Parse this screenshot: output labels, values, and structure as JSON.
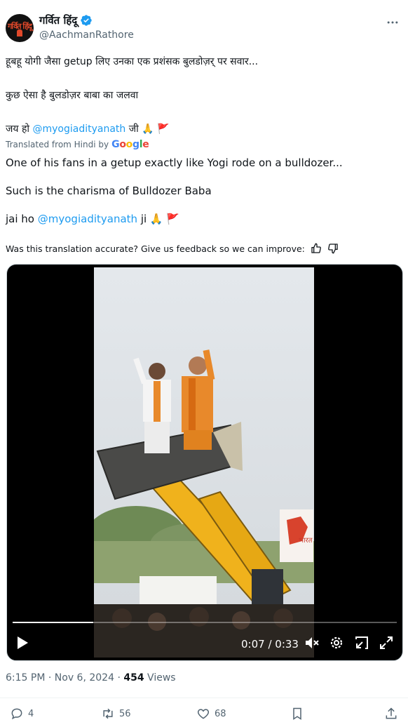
{
  "author": {
    "display_name": "गर्वित हिंदू",
    "handle": "@AachmanRathore",
    "avatar_text": "गर्वित हिंदू"
  },
  "post": {
    "hindi_line1": "हूबहू योगी जैसा getup लिए उनका एक प्रशंसक बुलडोज़र् पर सवार...",
    "hindi_line2": "कुछ ऐसा है बुलडोज़र बाबा का जलवा",
    "hindi_line3_prefix": "जय हो",
    "hindi_line3_mention": "@myogiadityanath",
    "hindi_line3_suffix": "जी 🙏 🚩",
    "translated_label": "Translated from Hindi by",
    "translator": "Google",
    "english_line1": "One of his fans in a getup exactly like Yogi rode on a bulldozer...",
    "english_line2": "Such is the charisma of Bulldozer Baba",
    "english_line3_prefix": "jai ho",
    "english_line3_mention": "@myogiadityanath",
    "english_line3_suffix": "ji 🙏 🚩",
    "feedback_text": "Was this translation accurate? Give us feedback so we can improve:"
  },
  "video": {
    "time_display": "0:07 / 0:33",
    "progress_fraction": 0.21,
    "poster_text": "भारत"
  },
  "meta": {
    "time": "6:15 PM",
    "separator": "·",
    "date": "Nov 6, 2024",
    "views_count": "454",
    "views_label": "Views"
  },
  "actions": {
    "replies": "4",
    "reposts": "56",
    "likes": "68"
  },
  "colors": {
    "accent": "#1d9bf0",
    "text": "#0f1419",
    "muted": "#536471",
    "saffron": "#e8892b",
    "bulldozer_yellow": "#f0b21c"
  },
  "icons": [
    "verified-badge-icon",
    "more-icon",
    "thumbs-up-icon",
    "thumbs-down-icon",
    "play-icon",
    "mute-icon",
    "settings-icon",
    "picture-in-picture-icon",
    "fullscreen-icon",
    "reply-icon",
    "repost-icon",
    "like-icon",
    "bookmark-icon",
    "share-icon"
  ]
}
